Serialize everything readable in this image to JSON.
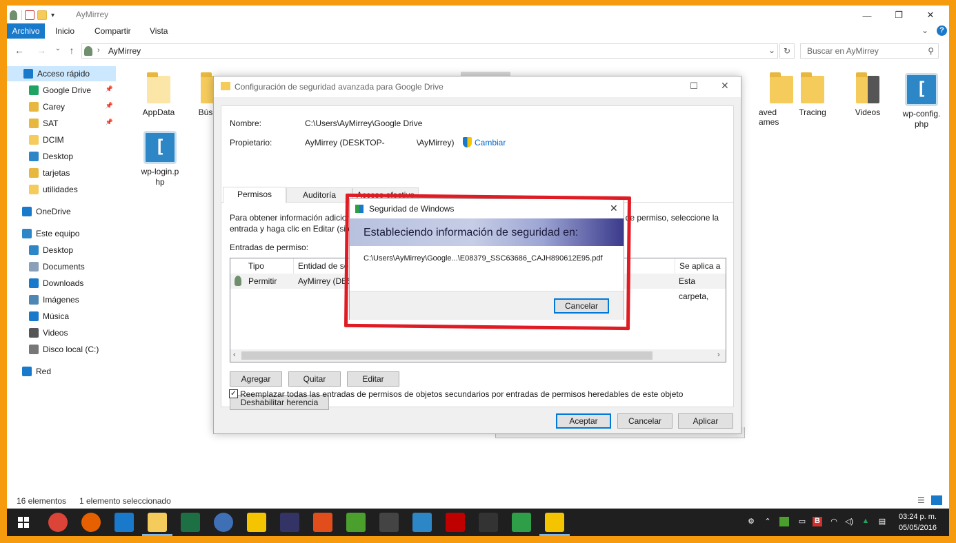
{
  "window": {
    "title": "AyMirrey",
    "ribbon_tabs": [
      "Archivo",
      "Inicio",
      "Compartir",
      "Vista"
    ],
    "address": "AyMirrey",
    "search_placeholder": "Buscar en AyMirrey"
  },
  "sidebar": {
    "items": [
      {
        "label": "Acceso rápido",
        "icon": "star-icon",
        "color": "#1979ca"
      },
      {
        "label": "Google Drive",
        "icon": "google-drive-icon",
        "color": "#1da462",
        "pinned": true
      },
      {
        "label": "Carey",
        "icon": "folder-user-icon",
        "color": "#e7b73f",
        "pinned": true
      },
      {
        "label": "SAT",
        "icon": "folder-check-icon",
        "color": "#e7b73f",
        "pinned": true
      },
      {
        "label": "DCIM",
        "icon": "folder-icon",
        "color": "#f5cb5c"
      },
      {
        "label": "Desktop",
        "icon": "desktop-icon",
        "color": "#2d86c6"
      },
      {
        "label": "tarjetas",
        "icon": "folder-user-icon",
        "color": "#e7b73f"
      },
      {
        "label": "utilidades",
        "icon": "folder-icon",
        "color": "#f5cb5c"
      },
      {
        "label": "OneDrive",
        "icon": "cloud-icon",
        "color": "#1979ca"
      },
      {
        "label": "Este equipo",
        "icon": "computer-icon",
        "color": "#2d86c6"
      },
      {
        "label": "Desktop",
        "icon": "desktop-icon",
        "color": "#2d86c6"
      },
      {
        "label": "Documents",
        "icon": "documents-icon",
        "color": "#8aa0b8"
      },
      {
        "label": "Downloads",
        "icon": "download-icon",
        "color": "#1979ca"
      },
      {
        "label": "Imágenes",
        "icon": "pictures-icon",
        "color": "#4f87b4"
      },
      {
        "label": "Música",
        "icon": "music-icon",
        "color": "#1979ca"
      },
      {
        "label": "Videos",
        "icon": "video-icon",
        "color": "#555555"
      },
      {
        "label": "Disco local (C:)",
        "icon": "drive-icon",
        "color": "#777777"
      },
      {
        "label": "Red",
        "icon": "network-icon",
        "color": "#1979ca"
      }
    ]
  },
  "files": {
    "appdata": "AppData",
    "busquedas": "Búsque",
    "saved_games_1": "aved",
    "saved_games_2": "ames",
    "tracing": "Tracing",
    "videos": "Videos",
    "wpconfig": "wp-config.\nphp",
    "wplogin": "wp-login.p\nhp"
  },
  "status": {
    "count": "16 elementos",
    "selected": "1 elemento seleccionado"
  },
  "dialog": {
    "title": "Configuración de seguridad avanzada para Google Drive",
    "name_label": "Nombre:",
    "name_value": "C:\\Users\\AyMirrey\\Google Drive",
    "owner_label": "Propietario:",
    "owner_value": "AyMirrey (DESKTOP-",
    "owner_value_end": "\\AyMirrey)",
    "change_link": "Cambiar",
    "tabs": [
      "Permisos",
      "Auditoría",
      "Acceso efectivo"
    ],
    "info_line1": "Para obtener información adicional, haga doble clic en una entrada de permiso. Para modificar una entrada de permiso, seleccione la",
    "info_line2": "entrada y haga clic en Editar (si e",
    "entries_label": "Entradas de permiso:",
    "columns": [
      "Tipo",
      "Entidad de seg",
      "Se aplica a"
    ],
    "row": {
      "tipo": "Permitir",
      "entidad": "AyMirrey (DES",
      "aplica": "Esta carpeta,"
    },
    "buttons": {
      "agregar": "Agregar",
      "quitar": "Quitar",
      "editar": "Editar",
      "deshabilitar": "Deshabilitar herencia"
    },
    "replace_checkbox": "Reemplazar todas las entradas de permisos de objetos secundarios por entradas de permisos heredables de este objeto",
    "replace_checked": true,
    "footer": {
      "aceptar": "Aceptar",
      "cancelar": "Cancelar",
      "aplicar": "Aplicar"
    }
  },
  "security_popup": {
    "title": "Seguridad de Windows",
    "heading": "Estableciendo información de seguridad en:",
    "path": "C:\\Users\\AyMirrey\\Google...\\E08379_SSC63686_CAJH890612E95.pdf",
    "cancel": "Cancelar",
    "highlight_color": "#e01b24"
  },
  "taskbar": {
    "apps": [
      {
        "name": "chrome-icon",
        "color": "#db4437"
      },
      {
        "name": "firefox-icon",
        "color": "#e66000"
      },
      {
        "name": "edge-icon",
        "color": "#1979ca"
      },
      {
        "name": "file-explorer-icon",
        "color": "#f5cb5c"
      },
      {
        "name": "excel-icon",
        "color": "#1d7044"
      },
      {
        "name": "thunderbird-icon",
        "color": "#3f6fb5"
      },
      {
        "name": "notes-icon",
        "color": "#f5c400"
      },
      {
        "name": "media-icon",
        "color": "#333366"
      },
      {
        "name": "flame-icon",
        "color": "#e24e1b"
      },
      {
        "name": "dreamweaver-icon",
        "color": "#4a9f2d"
      },
      {
        "name": "calculator-icon",
        "color": "#444444"
      },
      {
        "name": "brackets-icon",
        "color": "#2d86c6"
      },
      {
        "name": "filezilla-icon",
        "color": "#bf0000"
      },
      {
        "name": "inkscape-icon",
        "color": "#333333"
      },
      {
        "name": "camtasia-icon",
        "color": "#2e9e48"
      },
      {
        "name": "google-drive-icon",
        "color": "#f5c400"
      }
    ],
    "time": "03:24 p. m.",
    "date": "05/05/2016"
  }
}
